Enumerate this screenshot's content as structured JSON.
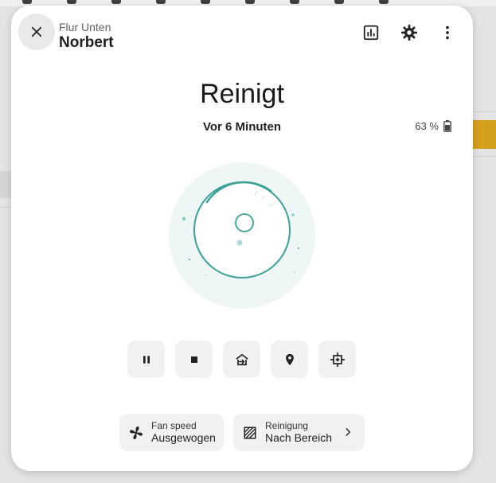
{
  "dialog": {
    "area": "Flur Unten",
    "name": "Norbert",
    "header_icons": [
      "history-chart-icon",
      "gear-icon",
      "more-vertical-icon"
    ]
  },
  "status": {
    "state": "Reinigt",
    "since": "Vor 6 Minuten",
    "battery": "63 %"
  },
  "controls": [
    "pause-icon",
    "stop-icon",
    "return-to-base-icon",
    "locate-icon",
    "clean-spot-icon"
  ],
  "fan_speed": {
    "label": "Fan speed",
    "value": "Ausgewogen",
    "icon": "fan-icon"
  },
  "cleaning_mode": {
    "label": "Reinigung",
    "value": "Nach Bereich",
    "icon": "area-hatch-icon"
  },
  "colors": {
    "accent": "#3aa196",
    "vacuum_bg": "#eef7f6",
    "button_bg": "#f1f1f1",
    "background_highlight": "#e2a91f"
  }
}
